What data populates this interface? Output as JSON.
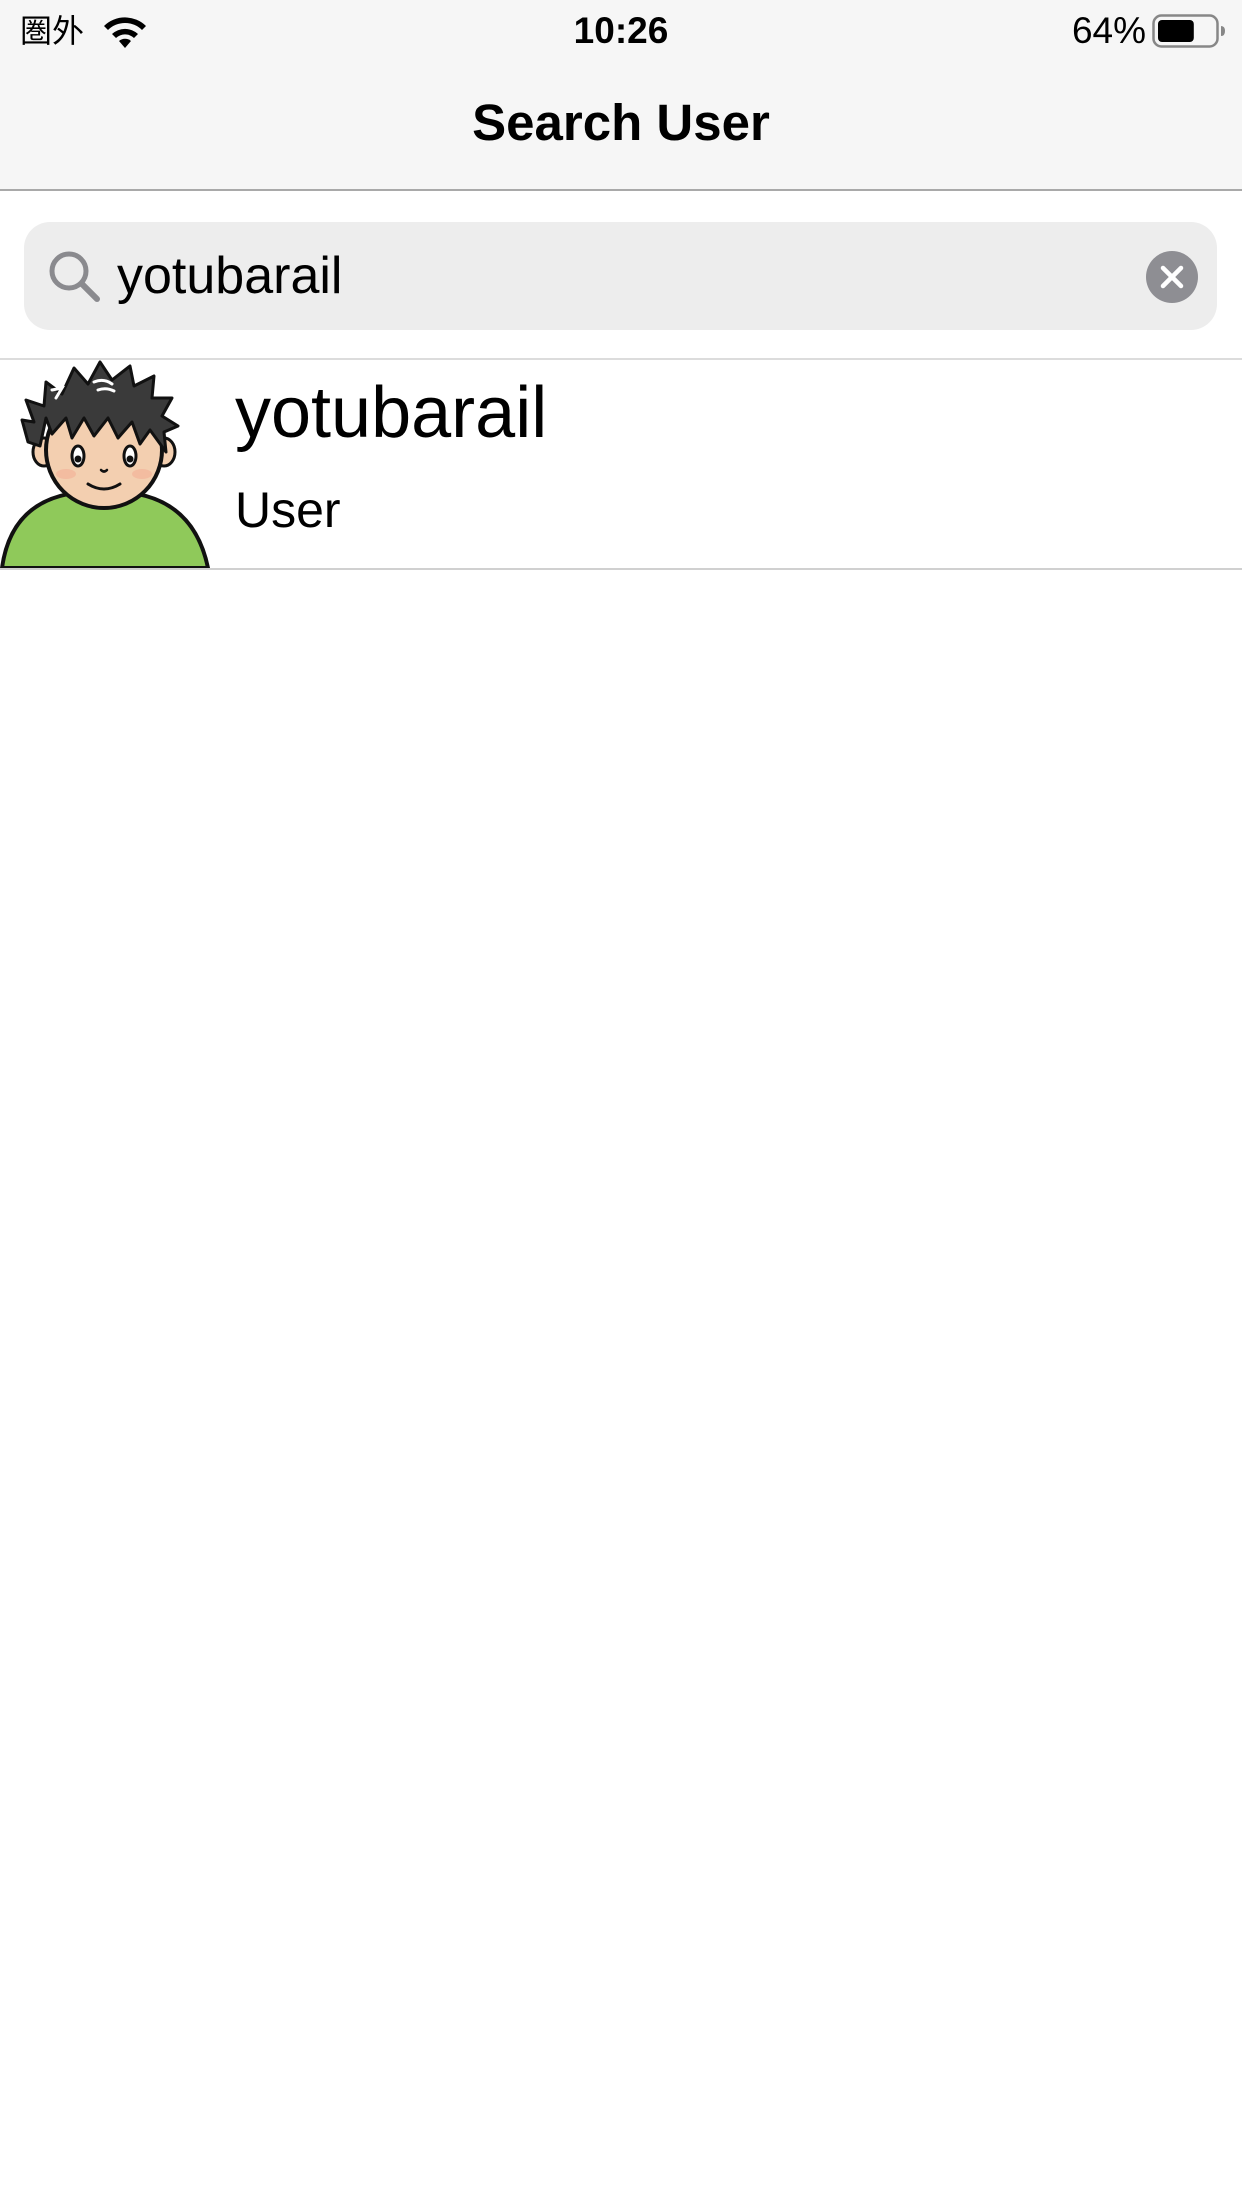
{
  "status_bar": {
    "carrier": "圏外",
    "time": "10:26",
    "battery_percent": "64%",
    "battery_level": 0.64,
    "wifi_icon": "wifi-icon",
    "battery_icon": "battery-icon"
  },
  "nav": {
    "title": "Search User"
  },
  "search": {
    "value": "yotubarail",
    "icon": "search-icon",
    "clear_icon": "clear-icon"
  },
  "results": [
    {
      "name": "yotubarail",
      "role": "User",
      "avatar_icon": "avatar",
      "shirt_color": "#8fc95a"
    }
  ],
  "colors": {
    "bar_background": "#f6f6f6",
    "search_field_background": "#ededed",
    "clear_button": "#8e8e93"
  }
}
